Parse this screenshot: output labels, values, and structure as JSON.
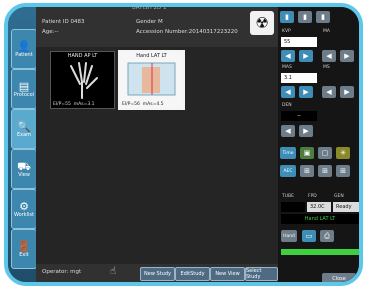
{
  "header": {
    "title_partial": "BAYISH 2D 1",
    "patient_id": "Patient ID 0483",
    "age": "Age:--",
    "gender": "Gender M",
    "accession": "Accession Number:20140317223220"
  },
  "sidebar": {
    "items": [
      {
        "label": "Patient",
        "icon": "patient-icon"
      },
      {
        "label": "Protocol",
        "icon": "protocol-icon"
      },
      {
        "label": "Exam",
        "icon": "exam-icon"
      },
      {
        "label": "View",
        "icon": "view-icon"
      },
      {
        "label": "Worklist",
        "icon": "worklist-icon"
      },
      {
        "label": "Exit",
        "icon": "exit-icon"
      }
    ]
  },
  "thumbnails": [
    {
      "title": "HAND AP LT",
      "ei": "EI/P=55",
      "ids": "mAs=3.1"
    },
    {
      "title": "Hand LAT LT",
      "ei": "EI/P=56",
      "ids": "mAs=4.5"
    }
  ],
  "footer": {
    "operator": "Operator: mgt",
    "buttons": [
      "New Study",
      "EditStudy",
      "New View",
      "Select Study"
    ]
  },
  "right_panel": {
    "kvp_label": "KVP",
    "ma_label": "MA",
    "kvp_value": "55",
    "mas_label": "MAS",
    "ms_label": "MS",
    "mas_value": "3.1",
    "den_label": "DEN",
    "den_value": "--",
    "time_label": "Time",
    "tube_label": "TUBE",
    "fpd_label": "FPD",
    "gen_label": "GEN",
    "tube_value": "",
    "fpd_value": "32.0C",
    "gen_value": "Ready",
    "view_name": "Hand LAT LT",
    "close_label": "Close",
    "accent": "#3fd03f"
  }
}
